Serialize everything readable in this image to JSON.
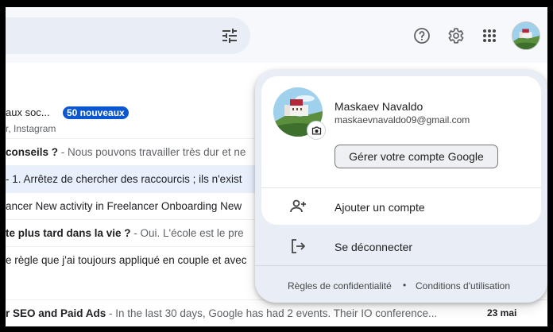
{
  "header": {
    "tune_icon": "tune-icon",
    "help_icon": "help-icon",
    "settings_icon": "gear-icon",
    "apps_icon": "apps-grid-icon"
  },
  "inbox": {
    "promotions": {
      "title": "aux soc...",
      "badge": "50 nouveaux",
      "subtitle": "r, Instagram"
    },
    "rows": [
      {
        "subject": "conseils ?",
        "snippet": " - Nous pouvons travailler très dur et ne",
        "selected": false,
        "date": ""
      },
      {
        "subject": "",
        "snippet": "- 1. Arrêtez de chercher des raccourcis ; ils n'exist",
        "selected": true,
        "date": ""
      },
      {
        "subject": "",
        "snippet": "ancer New activity in Freelancer Onboarding New",
        "selected": false,
        "date": ""
      },
      {
        "subject": "te plus tard dans la vie ?",
        "snippet": " - Oui. L'école est le pre",
        "selected": false,
        "date": ""
      },
      {
        "subject": "",
        "snippet": "e règle que j'ai toujours appliqué en couple et avec",
        "selected": false,
        "date": ""
      },
      {
        "subject": "r SEO and Paid Ads",
        "snippet": " - In the last 30 days, Google has had 2 events. Their IO conference...",
        "selected": false,
        "date": "23 mai"
      }
    ]
  },
  "account_menu": {
    "name": "Maskaev Navaldo",
    "email": "maskaevnavaldo09@gmail.com",
    "manage_label": "Gérer votre compte Google",
    "add_account_label": "Ajouter un compte",
    "sign_out_label": "Se déconnecter",
    "privacy_label": "Règles de confidentialité",
    "separator": "•",
    "terms_label": "Conditions d'utilisation"
  }
}
